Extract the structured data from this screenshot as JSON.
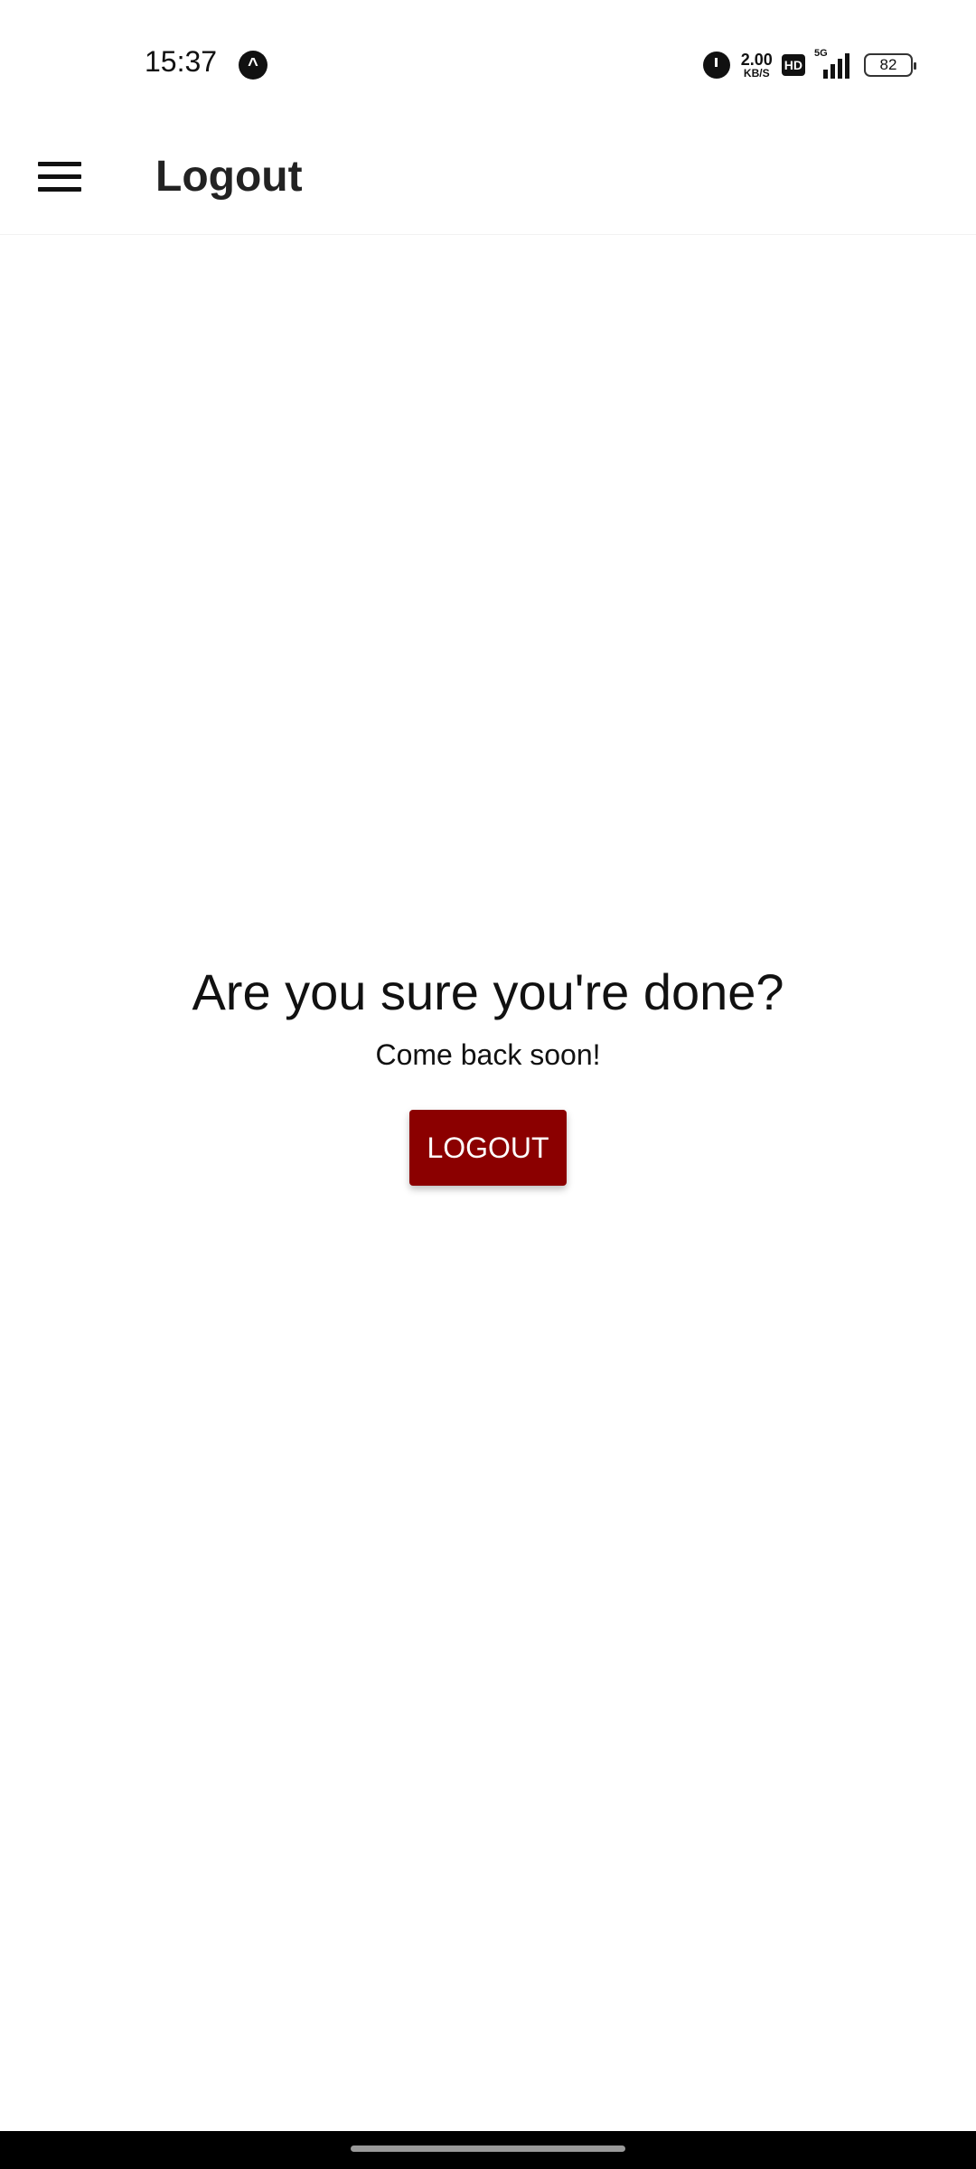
{
  "status_bar": {
    "time": "15:37",
    "app_icon": "navigation-arrow-icon",
    "alarm_icon": "alarm-icon",
    "net_speed_value": "2.00",
    "net_speed_unit": "KB/S",
    "hd_label": "HD",
    "network_label": "5G",
    "battery_level": "82"
  },
  "app_bar": {
    "menu_icon": "hamburger-menu-icon",
    "title": "Logout"
  },
  "main": {
    "heading": "Are you sure you're done?",
    "subheading": "Come back soon!",
    "logout_button_label": "LOGOUT"
  },
  "colors": {
    "accent": "#8b0000",
    "background": "#ffffff",
    "nav_bar": "#000000"
  }
}
